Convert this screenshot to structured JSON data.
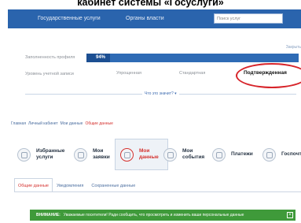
{
  "caption": "кабинет системы «Госуслуги»",
  "topbar": {
    "nav_left": "Государственные услуги",
    "nav_right": "Органы власти",
    "search_placeholder": "Поиск услуг"
  },
  "profile": {
    "close_link": "Закрыть",
    "completeness_label": "Заполненность профиля",
    "completeness_value": "94%",
    "completeness_fraction": 0.94,
    "level_label": "Уровень учетной записи",
    "levels": [
      "Упрощенная",
      "Стандартная",
      "Подтвержденная"
    ],
    "what_link": "Что это значит? ▾",
    "highlight_color": "#d7242a"
  },
  "breadcrumbs": [
    "Главная",
    "Личный кабинет",
    "Мои данные",
    "Общие данные"
  ],
  "tiles": [
    {
      "label": "Избранные услуги",
      "icon": "star-icon"
    },
    {
      "label": "Мои заявки",
      "icon": "document-icon"
    },
    {
      "label": "Мои данные",
      "icon": "user-icon"
    },
    {
      "label": "Мои события",
      "icon": "calendar-icon"
    },
    {
      "label": "Платежи",
      "icon": "ruble-icon"
    },
    {
      "label": "Госпочта",
      "icon": "mail-icon"
    }
  ],
  "tabs": [
    "Общие данные",
    "Уведомления",
    "Сохраненные данные"
  ],
  "notice": {
    "prefix": "ВНИМАНИЕ:",
    "text": "Уважаемые посетители! Ради сообщить, что просмотреть и изменить ваши персональные данные",
    "color": "#3f9a3a"
  }
}
